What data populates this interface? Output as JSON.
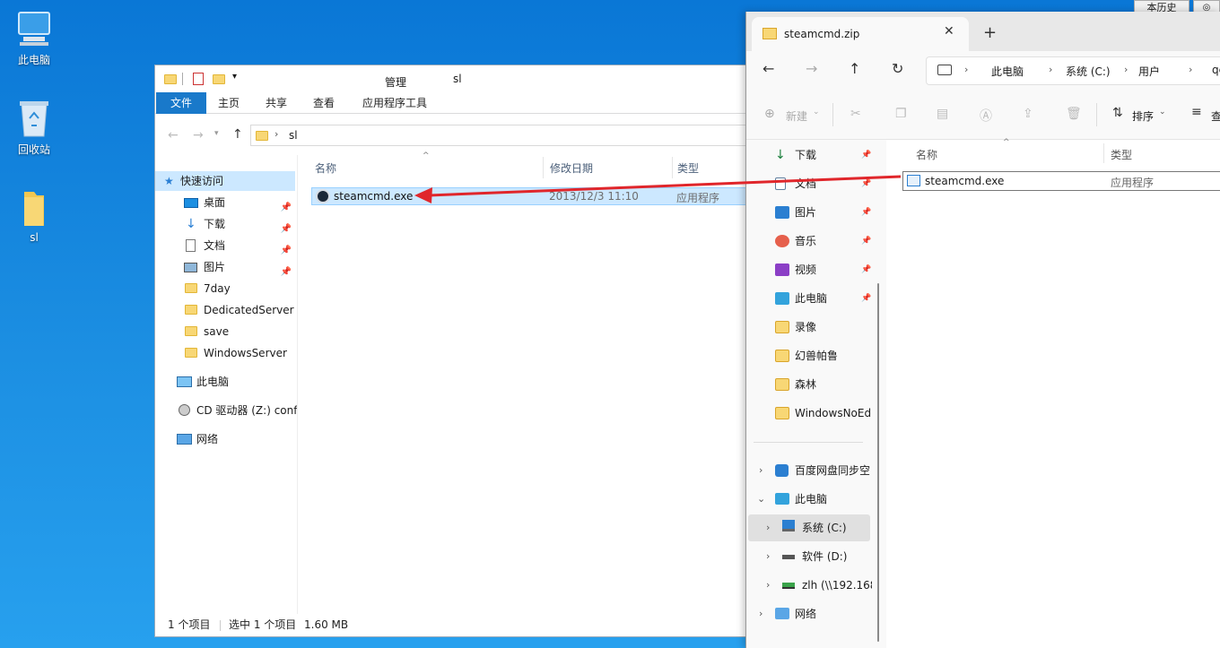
{
  "desktop": {
    "icons": [
      {
        "label": "此电脑"
      },
      {
        "label": "回收站"
      },
      {
        "label": "sl"
      }
    ],
    "corner_label": "本历史"
  },
  "explorer1": {
    "manage_label": "管理",
    "title": "sl",
    "tabs": [
      "文件",
      "主页",
      "共享",
      "查看",
      "应用程序工具"
    ],
    "address": "sl",
    "nav": {
      "quick_access": "快速访问",
      "items": [
        "桌面",
        "下载",
        "文档",
        "图片",
        "7day",
        "DedicatedServer",
        "save",
        "WindowsServer"
      ],
      "this_pc": "此电脑",
      "cd_drive": "CD 驱动器 (Z:) confi",
      "network": "网络"
    },
    "columns": [
      "名称",
      "修改日期",
      "类型"
    ],
    "file": {
      "name": "steamcmd.exe",
      "date": "2013/12/3 11:10",
      "type": "应用程序"
    },
    "status": {
      "count": "1 个项目",
      "selected": "选中 1 个项目",
      "size": "1.60 MB"
    }
  },
  "explorer2": {
    "tab_title": "steamcmd.zip",
    "breadcrumb": [
      "此电脑",
      "系统 (C:)",
      "用户",
      "qc"
    ],
    "commands": {
      "new": "新建",
      "sort": "排序",
      "view": "查"
    },
    "quick": [
      "下载",
      "文档",
      "图片",
      "音乐",
      "视频",
      "此电脑",
      "录像",
      "幻兽帕鲁",
      "森林",
      "WindowsNoEd"
    ],
    "tree": [
      "百度网盘同步空",
      "此电脑",
      "系统 (C:)",
      "软件 (D:)",
      "zlh (\\\\192.168",
      "网络"
    ],
    "columns": [
      "名称",
      "类型"
    ],
    "file": {
      "name": "steamcmd.exe",
      "type": "应用程序"
    }
  },
  "colors": {
    "accent": "#1979ca",
    "arrow": "#e0262b",
    "selection": "#cce8ff",
    "manage": "#e9d7f5"
  }
}
